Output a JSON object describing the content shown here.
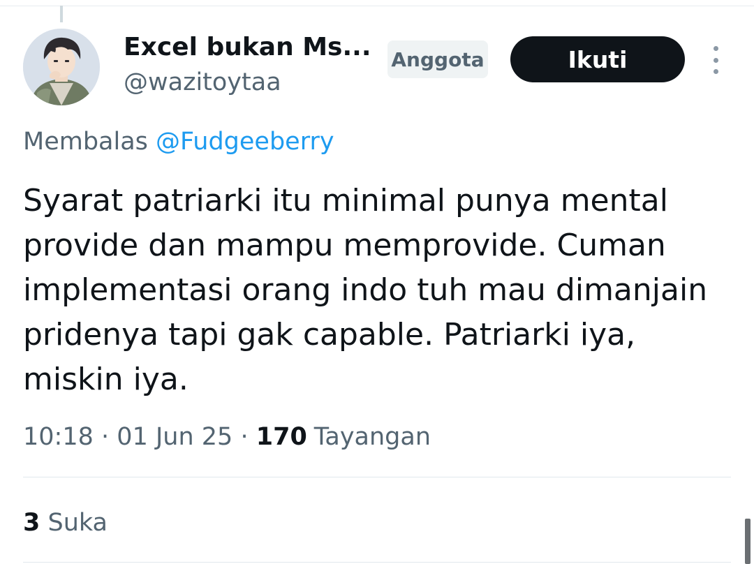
{
  "author": {
    "display_name": "Excel bukan Ms...",
    "handle": "@wazitoytaa",
    "badge": "Anggota"
  },
  "actions": {
    "follow_label": "Ikuti"
  },
  "reply": {
    "prefix": "Membalas",
    "mention": "@Fudgeeberry"
  },
  "tweet": {
    "text": "Syarat patriarki itu minimal punya mental\nprovide dan mampu memprovide. Cuman\nimplementasi orang indo tuh mau dimanjain\npridenya tapi gak capable. Patriarki iya,\nmiskin iya."
  },
  "meta": {
    "time": "10:18",
    "separator": "·",
    "date": "01 Jun 25",
    "views_count": "170",
    "views_label": "Tayangan"
  },
  "engagement": {
    "likes_count": "3",
    "likes_label": "Suka"
  },
  "colors": {
    "accent": "#1d9bf0",
    "follow_bg": "#0f1419",
    "secondary_text": "#536471"
  }
}
